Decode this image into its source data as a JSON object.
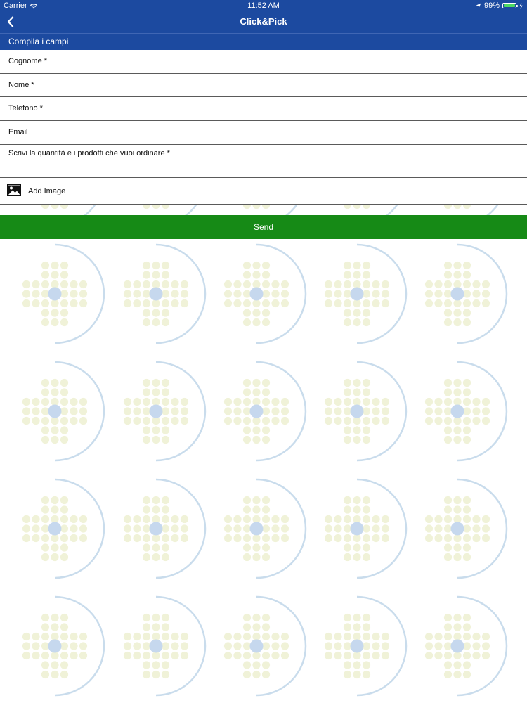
{
  "status_bar": {
    "carrier": "Carrier",
    "time": "11:52 AM",
    "battery": "99%",
    "battery_level": 0.99
  },
  "nav": {
    "title": "Click&Pick",
    "back_icon": "chevron-left-icon"
  },
  "form": {
    "section_title": "Compila i campi",
    "fields": [
      {
        "label": "Cognome *",
        "value": ""
      },
      {
        "label": "Nome *",
        "value": ""
      },
      {
        "label": "Telefono *",
        "value": ""
      },
      {
        "label": "Email",
        "value": ""
      },
      {
        "label": "Scrivi la quantità e i prodotti che vuoi ordinare *",
        "value": ""
      }
    ],
    "add_image_label": "Add Image",
    "add_image_icon": "image-icon",
    "send_label": "Send"
  },
  "colors": {
    "header_blue": "#1c4aa0",
    "send_green": "#168a16",
    "pattern_dots": "#f0f2d8",
    "pattern_arc": "#c9dcec",
    "pattern_center": "#c6d8ee"
  }
}
